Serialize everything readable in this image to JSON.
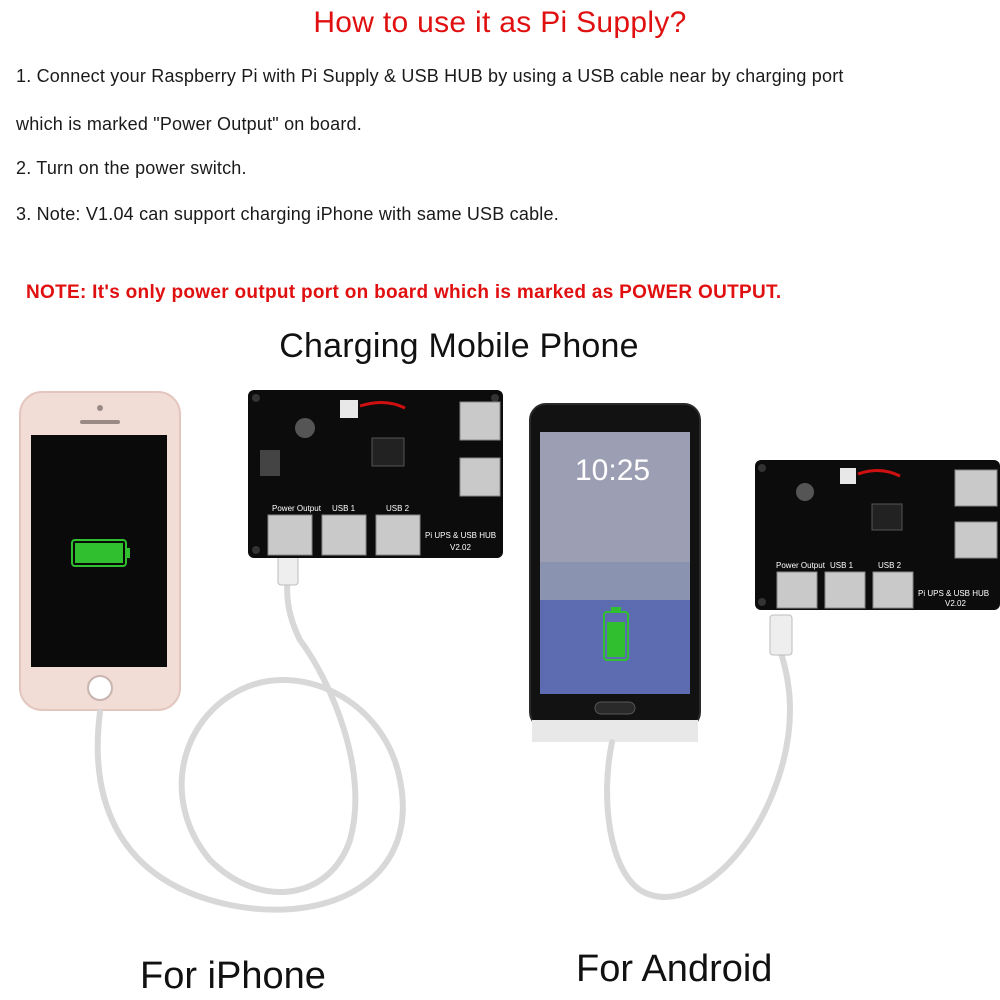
{
  "title": "How to use it as Pi Supply?",
  "steps": [
    "1. Connect your Raspberry Pi with Pi Supply & USB HUB by using a USB cable near by charging port",
    "which is marked \"Power Output\" on board.",
    "2. Turn on the power switch.",
    "3. Note: V1.04 can support charging iPhone with same USB cable."
  ],
  "note": "NOTE: It's only power output port on board which is marked as POWER OUTPUT.",
  "subheading": "Charging Mobile Phone",
  "left": {
    "caption": "For iPhone",
    "board_label": "Pi UPS & USB HUB",
    "board_version": "V2.02",
    "port_labels": [
      "Power Output",
      "USB 1",
      "USB 2"
    ]
  },
  "right": {
    "caption": "For Android",
    "phone_time": "10:25",
    "board_label": "Pi UPS & USB HUB",
    "board_version": "V2.02",
    "port_labels": [
      "Power Output",
      "USB 1",
      "USB 2"
    ]
  },
  "colors": {
    "title_red": "#e01010",
    "board_black": "#0c0c0c",
    "battery_green": "#2fbf2f",
    "iphone_body": "#f2dcd6"
  }
}
